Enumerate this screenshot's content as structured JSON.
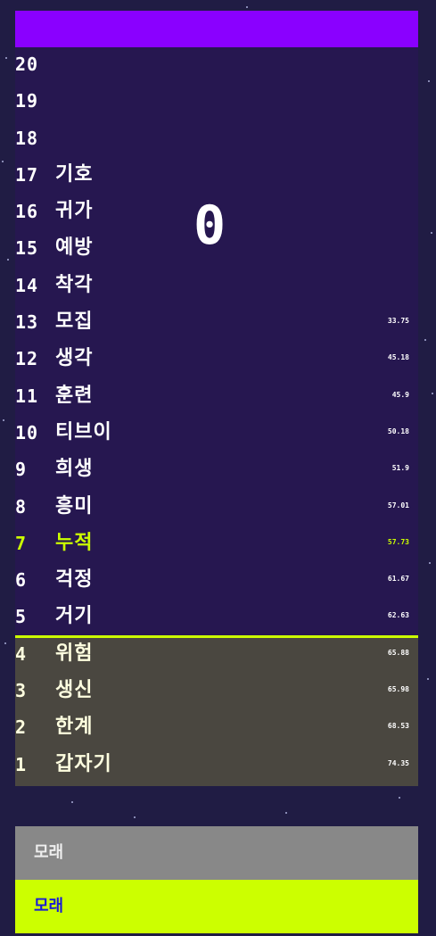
{
  "game": {
    "counter": "0",
    "input_value": "모래",
    "submit_value": "모래"
  },
  "colors": {
    "background": "#201c44",
    "panel": "#261750",
    "topbar": "#8a00ff",
    "danger_zone": "#4a4740",
    "accent": "#ccff00",
    "input_bg": "#888888",
    "submit_text": "#1a1ad6"
  },
  "rows": [
    {
      "num": "20",
      "word": "",
      "score": ""
    },
    {
      "num": "19",
      "word": "",
      "score": ""
    },
    {
      "num": "18",
      "word": "",
      "score": ""
    },
    {
      "num": "17",
      "word": "기호",
      "score": ""
    },
    {
      "num": "16",
      "word": "귀가",
      "score": ""
    },
    {
      "num": "15",
      "word": "예방",
      "score": ""
    },
    {
      "num": "14",
      "word": "착각",
      "score": ""
    },
    {
      "num": "13",
      "word": "모집",
      "score": "33.75"
    },
    {
      "num": "12",
      "word": "생각",
      "score": "45.18"
    },
    {
      "num": "11",
      "word": "훈련",
      "score": "45.9"
    },
    {
      "num": "10",
      "word": "티브이",
      "score": "50.18"
    },
    {
      "num": "9",
      "word": "희생",
      "score": "51.9"
    },
    {
      "num": "8",
      "word": "흥미",
      "score": "57.01"
    },
    {
      "num": "7",
      "word": "누적",
      "score": "57.73"
    },
    {
      "num": "6",
      "word": "걱정",
      "score": "61.67"
    },
    {
      "num": "5",
      "word": "거기",
      "score": "62.63"
    },
    {
      "num": "4",
      "word": "위험",
      "score": "65.88"
    },
    {
      "num": "3",
      "word": "생신",
      "score": "65.98"
    },
    {
      "num": "2",
      "word": "한계",
      "score": "68.53"
    },
    {
      "num": "1",
      "word": "갑자기",
      "score": "74.35"
    }
  ]
}
